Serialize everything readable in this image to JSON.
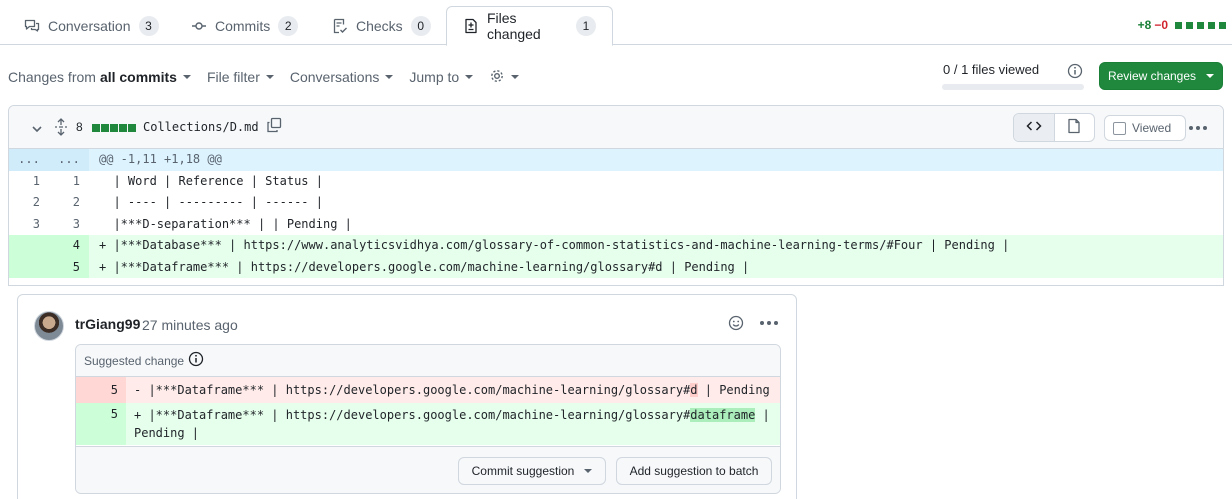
{
  "tabs": [
    {
      "label": "Conversation",
      "count": "3",
      "icon": "conversation-icon"
    },
    {
      "label": "Commits",
      "count": "2",
      "icon": "commit-icon"
    },
    {
      "label": "Checks",
      "count": "0",
      "icon": "checklist-icon"
    },
    {
      "label": "Files changed",
      "count": "1",
      "icon": "file-diff-icon",
      "active": true
    }
  ],
  "diffstat": {
    "additions": "+8",
    "deletions": "−0"
  },
  "toolbar": {
    "changes_prefix": "Changes from",
    "changes_value": "all commits",
    "file_filter": "File filter",
    "conversations": "Conversations",
    "jump_to": "Jump to",
    "files_viewed": "0 / 1 files viewed",
    "files_viewed_fraction": 0,
    "review_button": "Review changes"
  },
  "file": {
    "changes_count": "8",
    "name": "Collections/D.md",
    "viewed_label": "Viewed",
    "viewed_checked": false
  },
  "diff": {
    "hunk_left": "...",
    "hunk_right": "...",
    "hunk_header": "@@ -1,11 +1,18 @@",
    "lines": [
      {
        "type": "context",
        "old": "1",
        "new": "1",
        "text": "  | Word | Reference | Status |"
      },
      {
        "type": "context",
        "old": "2",
        "new": "2",
        "text": "  | ---- | --------- | ------ |"
      },
      {
        "type": "context",
        "old": "3",
        "new": "3",
        "text": "  |***D-separation*** | | Pending |"
      },
      {
        "type": "addition",
        "old": "",
        "new": "4",
        "text": "+ |***Database*** | https://www.analyticsvidhya.com/glossary-of-common-statistics-and-machine-learning-terms/#Four | Pending |"
      },
      {
        "type": "addition",
        "old": "",
        "new": "5",
        "text": "+ |***Dataframe*** | https://developers.google.com/machine-learning/glossary#d | Pending |"
      }
    ]
  },
  "comment": {
    "author": "trGiang99",
    "time": "27 minutes ago",
    "suggestion_title": "Suggested change",
    "deleted_line_no": "5",
    "deleted_before": "- |***Dataframe*** | https://developers.google.com/machine-learning/glossary#",
    "deleted_highlight": "d",
    "deleted_after": " | Pending |",
    "added_line_no": "5",
    "added_before": "+ |***Dataframe*** | https://developers.google.com/machine-learning/glossary#",
    "added_highlight": "dataframe",
    "added_after": " |",
    "added_wrap": "Pending |",
    "commit_button": "Commit suggestion",
    "batch_button": "Add suggestion to batch"
  }
}
